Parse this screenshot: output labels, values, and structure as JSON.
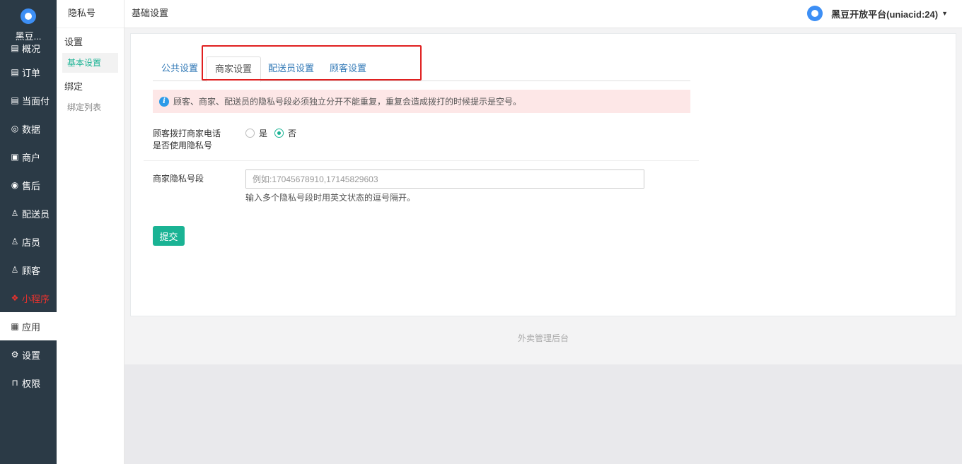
{
  "brand": {
    "name": "黑豆..."
  },
  "nav": [
    {
      "key": "overview",
      "label": "概况",
      "icon": "▤"
    },
    {
      "key": "orders",
      "label": "订单",
      "icon": "▤"
    },
    {
      "key": "face-pay",
      "label": "当面付",
      "icon": "▤"
    },
    {
      "key": "data",
      "label": "数据",
      "icon": "◎"
    },
    {
      "key": "merchant",
      "label": "商户",
      "icon": "▣"
    },
    {
      "key": "aftersale",
      "label": "售后",
      "icon": "◉"
    },
    {
      "key": "courier",
      "label": "配送员",
      "icon": "♙"
    },
    {
      "key": "staff",
      "label": "店员",
      "icon": "♙"
    },
    {
      "key": "customer",
      "label": "顾客",
      "icon": "♙"
    },
    {
      "key": "miniapp",
      "label": "小程序",
      "icon": "❖"
    },
    {
      "key": "apps",
      "label": "应用",
      "icon": "▦"
    },
    {
      "key": "settings",
      "label": "设置",
      "icon": "⚙"
    },
    {
      "key": "permissions",
      "label": "权限",
      "icon": "⊓"
    }
  ],
  "subnav": {
    "title": "隐私号",
    "groups": [
      {
        "label": "设置",
        "items": [
          {
            "label": "基本设置"
          }
        ]
      },
      {
        "label": "绑定",
        "items": [
          {
            "label": "绑定列表"
          }
        ]
      }
    ]
  },
  "header": {
    "title": "基础设置",
    "user": "黑豆开放平台(uniacid:24)"
  },
  "tabs": [
    {
      "label": "公共设置"
    },
    {
      "label": "商家设置"
    },
    {
      "label": "配送员设置"
    },
    {
      "label": "顾客设置"
    }
  ],
  "alert": {
    "text": "顾客、商家、配送员的隐私号段必须独立分开不能重复，重复会造成拨打的时候提示是空号。"
  },
  "form": {
    "use_privacy": {
      "label_line1": "顾客拨打商家电话",
      "label_line2": "是否使用隐私号",
      "options": [
        "是",
        "否"
      ],
      "selected": "否"
    },
    "merchant_numbers": {
      "label": "商家隐私号段",
      "placeholder": "例如:17045678910,17145829603",
      "value": "",
      "help": "输入多个隐私号段时用英文状态的逗号隔开。"
    },
    "submit_label": "提交"
  },
  "footer": {
    "text": "外卖管理后台"
  },
  "colors": {
    "accent": "#1ab394",
    "sidebar": "#2b3a46",
    "alert_bg": "#fde7e7",
    "highlight": "#e02020"
  }
}
